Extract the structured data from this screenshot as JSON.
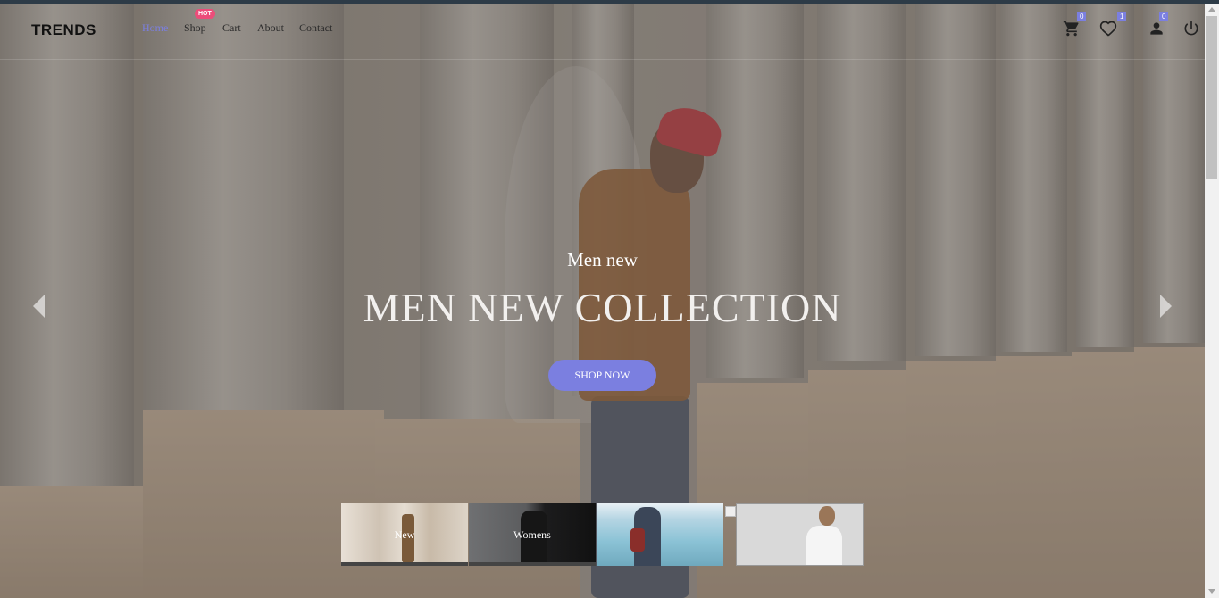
{
  "brand": {
    "logo": "TRENDS"
  },
  "nav": {
    "links": [
      {
        "label": "Home",
        "active": true
      },
      {
        "label": "Shop",
        "badge": "HOT"
      },
      {
        "label": "Cart"
      },
      {
        "label": "About"
      },
      {
        "label": "Contact"
      }
    ],
    "icons": {
      "cart": {
        "icon": "cart-icon",
        "count": "0"
      },
      "wishlist": {
        "icon": "heart-icon",
        "count": "1"
      },
      "account": {
        "icon": "user-icon",
        "count": "0"
      },
      "logout": {
        "icon": "power-icon"
      }
    }
  },
  "hero": {
    "subtitle": "Men new",
    "title": "MEN NEW COLLECTION",
    "button": "SHOP NOW"
  },
  "thumbnails": [
    {
      "label": "New"
    },
    {
      "label": "Womens"
    },
    {
      "label": ""
    },
    {
      "label": ""
    }
  ],
  "colors": {
    "accent": "#7b7fe0",
    "hot_badge": "#ec4d7a"
  }
}
